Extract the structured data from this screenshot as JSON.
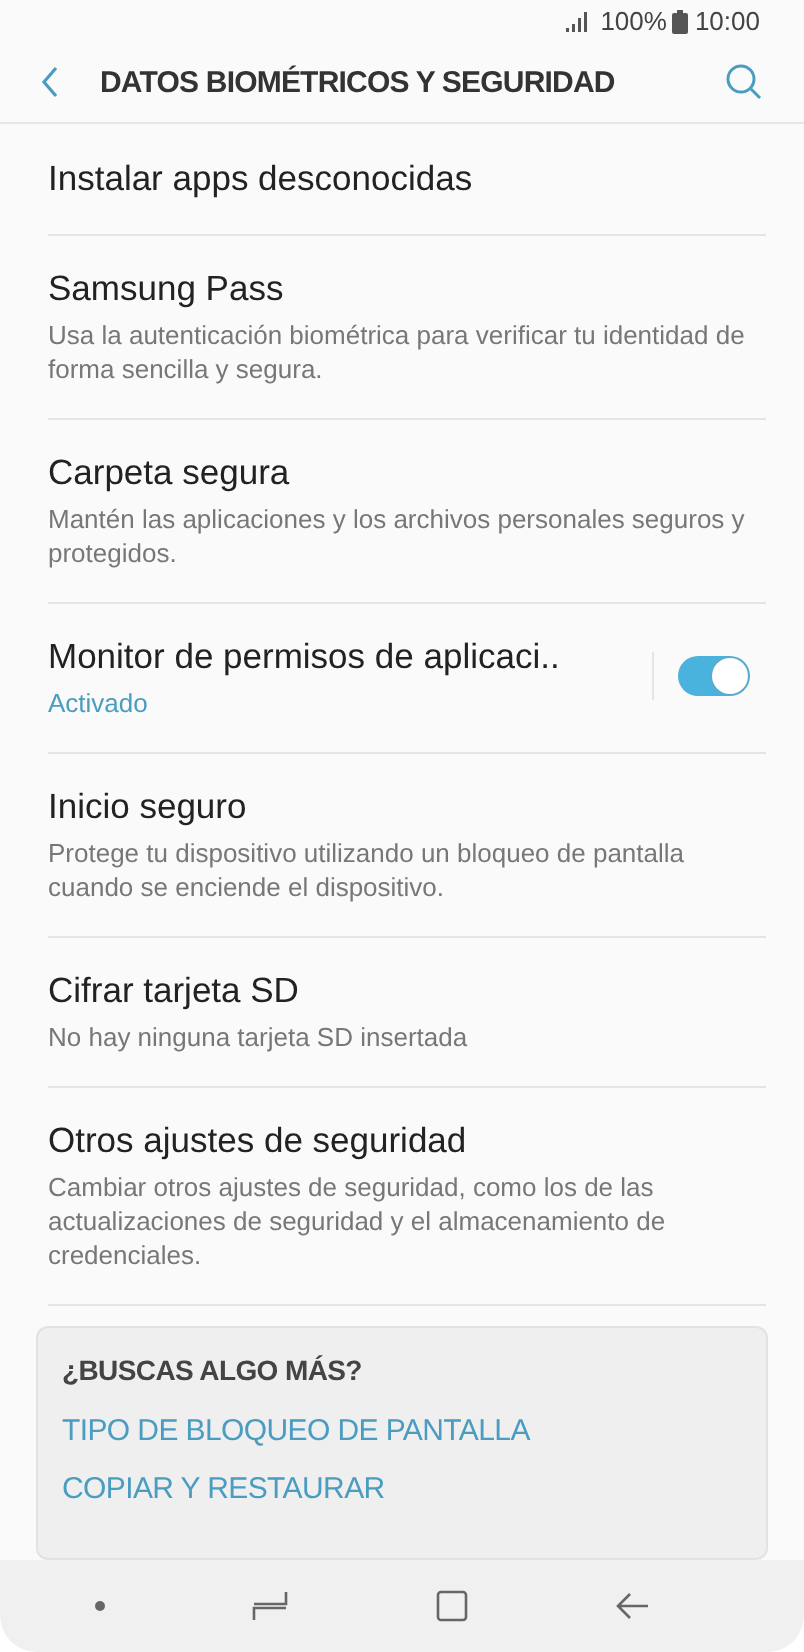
{
  "status_bar": {
    "battery": "100%",
    "time": "10:00"
  },
  "header": {
    "title": "DATOS BIOMÉTRICOS Y SEGURIDAD"
  },
  "items": [
    {
      "kind": "plain",
      "title": "Instalar apps desconocidas"
    },
    {
      "kind": "plain",
      "title": "Samsung Pass",
      "summary": "Usa la autenticación biométrica para verificar tu identidad de forma sencilla y segura."
    },
    {
      "kind": "plain",
      "title": "Carpeta segura",
      "summary": "Mantén las aplicaciones y los archivos personales seguros y protegidos."
    },
    {
      "kind": "toggle",
      "title": "Monitor de permisos de aplicaci..",
      "summary": "Activado",
      "on": true
    },
    {
      "kind": "plain",
      "title": "Inicio seguro",
      "summary": "Protege tu dispositivo utilizando un bloqueo de pantalla cuando se enciende el dispositivo."
    },
    {
      "kind": "plain",
      "title": "Cifrar tarjeta SD",
      "summary": "No hay ninguna tarjeta SD insertada"
    },
    {
      "kind": "plain",
      "title": "Otros ajustes de seguridad",
      "summary": "Cambiar otros ajustes de seguridad, como los de las actualizaciones de seguridad y el almacenamiento de credenciales."
    }
  ],
  "suggestions": {
    "title": "¿BUSCAS ALGO MÁS?",
    "links": [
      "TIPO DE BLOQUEO DE PANTALLA",
      "COPIAR Y RESTAURAR"
    ]
  }
}
